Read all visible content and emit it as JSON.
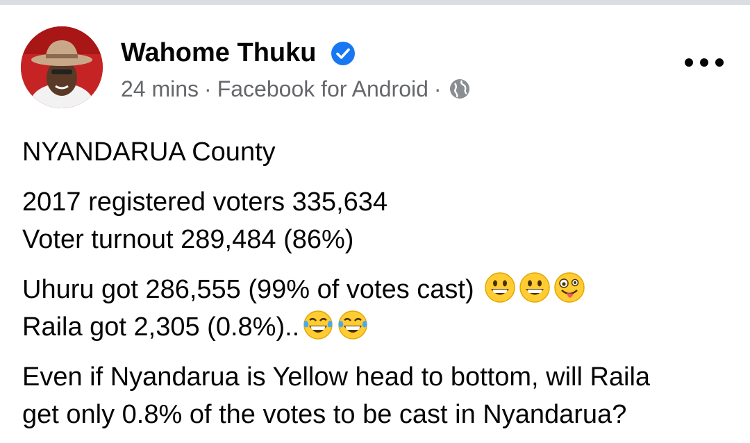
{
  "post": {
    "author": "Wahome Thuku",
    "timestamp": "24 mins",
    "source": "Facebook for Android",
    "separator": "·",
    "privacy_icon": "globe-icon",
    "verified_icon": "verified-badge-icon",
    "more_icon": "more-options-icon",
    "lines": {
      "l1": "NYANDARUA County",
      "l2": "2017 registered voters 335,634",
      "l3": "Voter turnout 289,484 (86%)",
      "l4": "Uhuru got 286,555 (99% of votes cast)",
      "l5": "Raila got 2,305 (0.8%)..",
      "l6": "Even if Nyandarua is Yellow head to bottom, will Raila",
      "l7": "get only 0.8% of the votes to be cast in Nyandarua?"
    },
    "emojis_line4": [
      "grinning-face-emoji",
      "grinning-face-emoji",
      "zany-face-emoji"
    ],
    "emojis_line5": [
      "tears-of-joy-emoji",
      "tears-of-joy-emoji"
    ]
  },
  "colors": {
    "text": "#050505",
    "secondary": "#65676b",
    "verified": "#1877f2",
    "avatar_bg": "#c21f1f"
  }
}
